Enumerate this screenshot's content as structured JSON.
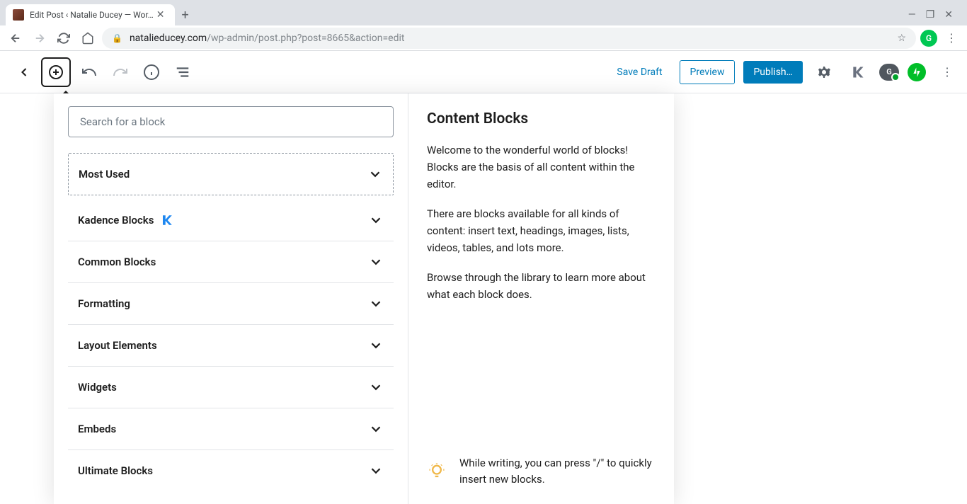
{
  "browser": {
    "tab_title": "Edit Post ‹ Natalie Ducey — Wor…",
    "url_domain": "natalieducey.com",
    "url_path": "/wp-admin/post.php?post=8665&action=edit"
  },
  "toolbar": {
    "tooltip": "Add block",
    "save_draft": "Save Draft",
    "preview": "Preview",
    "publish": "Publish…"
  },
  "inserter": {
    "search_placeholder": "Search for a block",
    "categories": [
      {
        "label": "Most Used",
        "icon": null
      },
      {
        "label": "Kadence Blocks",
        "icon": "kadence"
      },
      {
        "label": "Common Blocks",
        "icon": null
      },
      {
        "label": "Formatting",
        "icon": null
      },
      {
        "label": "Layout Elements",
        "icon": null
      },
      {
        "label": "Widgets",
        "icon": null
      },
      {
        "label": "Embeds",
        "icon": null
      },
      {
        "label": "Ultimate Blocks",
        "icon": null
      }
    ],
    "info": {
      "heading": "Content Blocks",
      "p1": "Welcome to the wonderful world of blocks! Blocks are the basis of all content within the editor.",
      "p2": "There are blocks available for all kinds of content: insert text, headings, images, lists, videos, tables, and lots more.",
      "p3": "Browse through the library to learn more about what each block does.",
      "tip": "While writing, you can press \"/\" to quickly insert new blocks."
    }
  }
}
